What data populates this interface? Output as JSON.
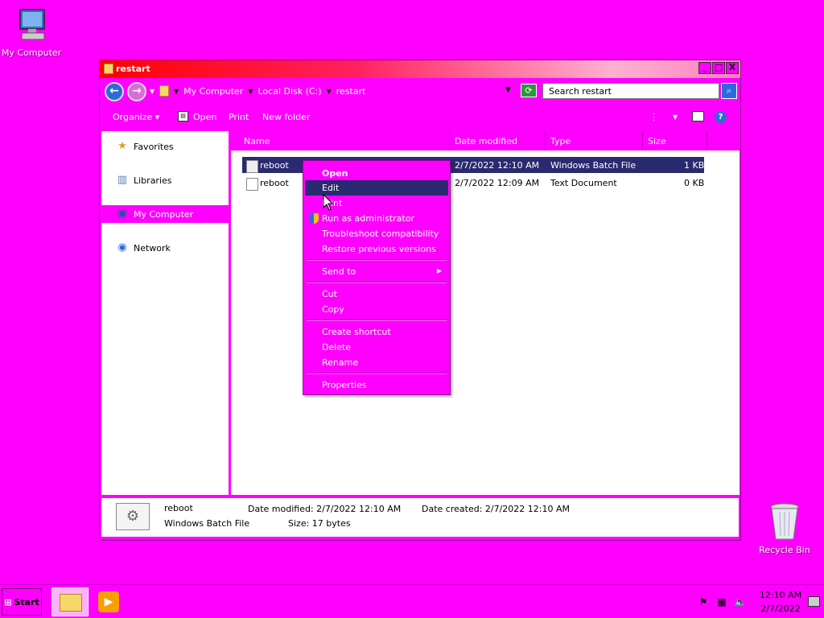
{
  "desktop": {
    "my_computer_label": "My Computer",
    "recycle_bin_label": "Recycle Bin"
  },
  "window": {
    "title": "restart",
    "breadcrumbs": [
      "My Computer",
      "Local Disk (C:)",
      "restart"
    ],
    "search_placeholder": "Search restart",
    "controls": {
      "minimize": "_",
      "maximize": "□",
      "close": "X"
    }
  },
  "toolbar": {
    "organize": "Organize",
    "open": "Open",
    "print": "Print",
    "new_folder": "New folder"
  },
  "nav": {
    "items": [
      {
        "label": "Favorites",
        "icon": "star-icon",
        "selected": false
      },
      {
        "label": "Libraries",
        "icon": "libraries-icon",
        "selected": false
      },
      {
        "label": "My Computer",
        "icon": "computer-icon",
        "selected": true
      },
      {
        "label": "Network",
        "icon": "network-icon",
        "selected": false
      }
    ]
  },
  "filelist": {
    "columns": [
      "Name",
      "Date modified",
      "Type",
      "Size"
    ],
    "rows": [
      {
        "name": "reboot",
        "date": "2/7/2022 12:10 AM",
        "type": "Windows Batch File",
        "size": "1 KB",
        "selected": true,
        "icon": "batch-file-icon"
      },
      {
        "name": "reboot",
        "date": "2/7/2022 12:09 AM",
        "type": "Text Document",
        "size": "0 KB",
        "selected": false,
        "icon": "text-file-icon"
      }
    ]
  },
  "details": {
    "name": "reboot",
    "type": "Windows Batch File",
    "date_modified": "Date modified: 2/7/2022 12:10 AM",
    "date_created": "Date created: 2/7/2022 12:10 AM",
    "size": "Size: 17 bytes"
  },
  "context_menu": {
    "open": "Open",
    "edit": "Edit",
    "print": "Print",
    "run_as_admin": "Run as administrator",
    "troubleshoot": "Troubleshoot compatibility",
    "restore": "Restore previous versions",
    "send_to": "Send to",
    "cut": "Cut",
    "copy": "Copy",
    "create_shortcut": "Create shortcut",
    "delete": "Delete",
    "rename": "Rename",
    "properties": "Properties"
  },
  "taskbar": {
    "start": "Start",
    "time": "12:10 AM",
    "date": "2/7/2022"
  },
  "colors": {
    "theme": "#ff00ff",
    "selection": "#2a2a70"
  }
}
